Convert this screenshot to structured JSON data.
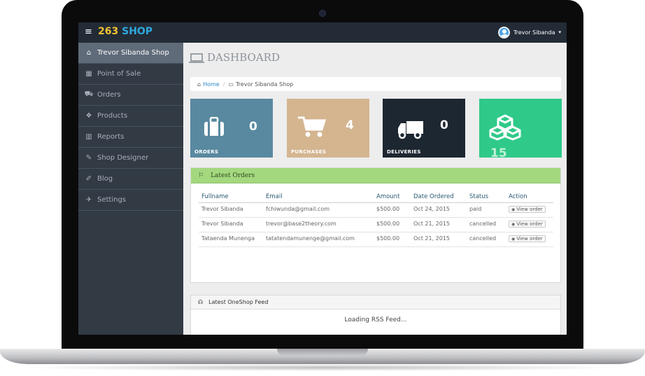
{
  "topbar": {
    "menu_icon": "hamburger-icon",
    "brand_num": "263",
    "brand_word": "SHOP",
    "user_name": "Trevor Sibanda",
    "caret": "▾"
  },
  "sidebar": {
    "items": [
      {
        "label": "Trevor Sibanda Shop",
        "icon": "home-icon",
        "glyph": "⌂"
      },
      {
        "label": "Point of Sale",
        "icon": "calculator-icon",
        "glyph": "▦"
      },
      {
        "label": "Orders",
        "icon": "cart-icon",
        "glyph": "⛟"
      },
      {
        "label": "Products",
        "icon": "cubes-icon",
        "glyph": "❖"
      },
      {
        "label": "Reports",
        "icon": "bar-chart-icon",
        "glyph": "▥"
      },
      {
        "label": "Shop Designer",
        "icon": "brush-icon",
        "glyph": "✎"
      },
      {
        "label": "Blog",
        "icon": "edit-icon",
        "glyph": "✐"
      },
      {
        "label": "Settings",
        "icon": "wrench-icon",
        "glyph": "✈"
      }
    ]
  },
  "page": {
    "title": "DASHBOARD",
    "breadcrumb_home": "Home",
    "breadcrumb_sep": "/",
    "breadcrumb_current": "Trevor Sibanda Shop"
  },
  "stats": [
    {
      "label": "ORDERS",
      "value": "0",
      "icon": "briefcase-icon",
      "color": "#5989a0"
    },
    {
      "label": "PURCHASES",
      "value": "4",
      "icon": "shopping-cart-icon",
      "color": "#d4b590"
    },
    {
      "label": "DELIVERIES",
      "value": "0",
      "icon": "truck-icon",
      "color": "#1d2731"
    },
    {
      "label": "",
      "value": "15",
      "icon": "cubes-icon",
      "color": "#2fc98a"
    }
  ],
  "orders": {
    "title": "Latest Orders",
    "columns": [
      "Fullname",
      "Email",
      "Amount",
      "Date Ordered",
      "Status",
      "Action"
    ],
    "rows": [
      {
        "fullname": "Trevor Sibanda",
        "email": "fchiwunda@gmail.com",
        "amount": "$500.00",
        "date": "Oct 24, 2015",
        "status": "paid",
        "action": "View order"
      },
      {
        "fullname": "Trevor Sibanda",
        "email": "trevor@base2theory.com",
        "amount": "$500.00",
        "date": "Oct 21, 2015",
        "status": "cancelled",
        "action": "View order"
      },
      {
        "fullname": "Tataenda Munenga",
        "email": "tatatendamunenge@gmail.com",
        "amount": "$500.00",
        "date": "Oct 21, 2015",
        "status": "cancelled",
        "action": "View order"
      }
    ]
  },
  "feed": {
    "title": "Latest OneShop Feed",
    "loading": "Loading RSS Feed..."
  }
}
